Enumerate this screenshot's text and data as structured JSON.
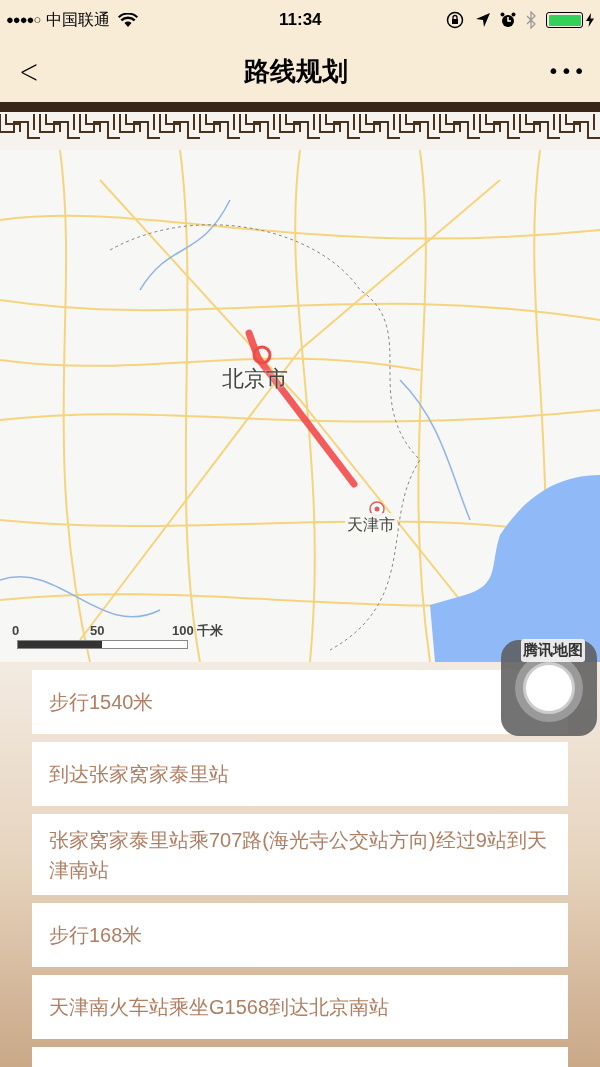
{
  "status_bar": {
    "signal_dots": "●●●●○",
    "carrier": "中国联通",
    "time": "11:34"
  },
  "nav": {
    "title": "路线规划",
    "back": "<",
    "more": "•••"
  },
  "map": {
    "cities": [
      "北京市",
      "天津市"
    ],
    "scale": [
      "0",
      "50",
      "100 千米"
    ],
    "logo": "腾讯地图"
  },
  "steps": [
    {
      "text": "步行1540米"
    },
    {
      "text": "到达张家窝家泰里站"
    },
    {
      "text": "张家窝家泰里站乘707路(海光寺公交站方向)经过9站到天津南站"
    },
    {
      "text": "步行168米"
    },
    {
      "text": "天津南火车站乘坐G1568到达北京南站"
    }
  ]
}
